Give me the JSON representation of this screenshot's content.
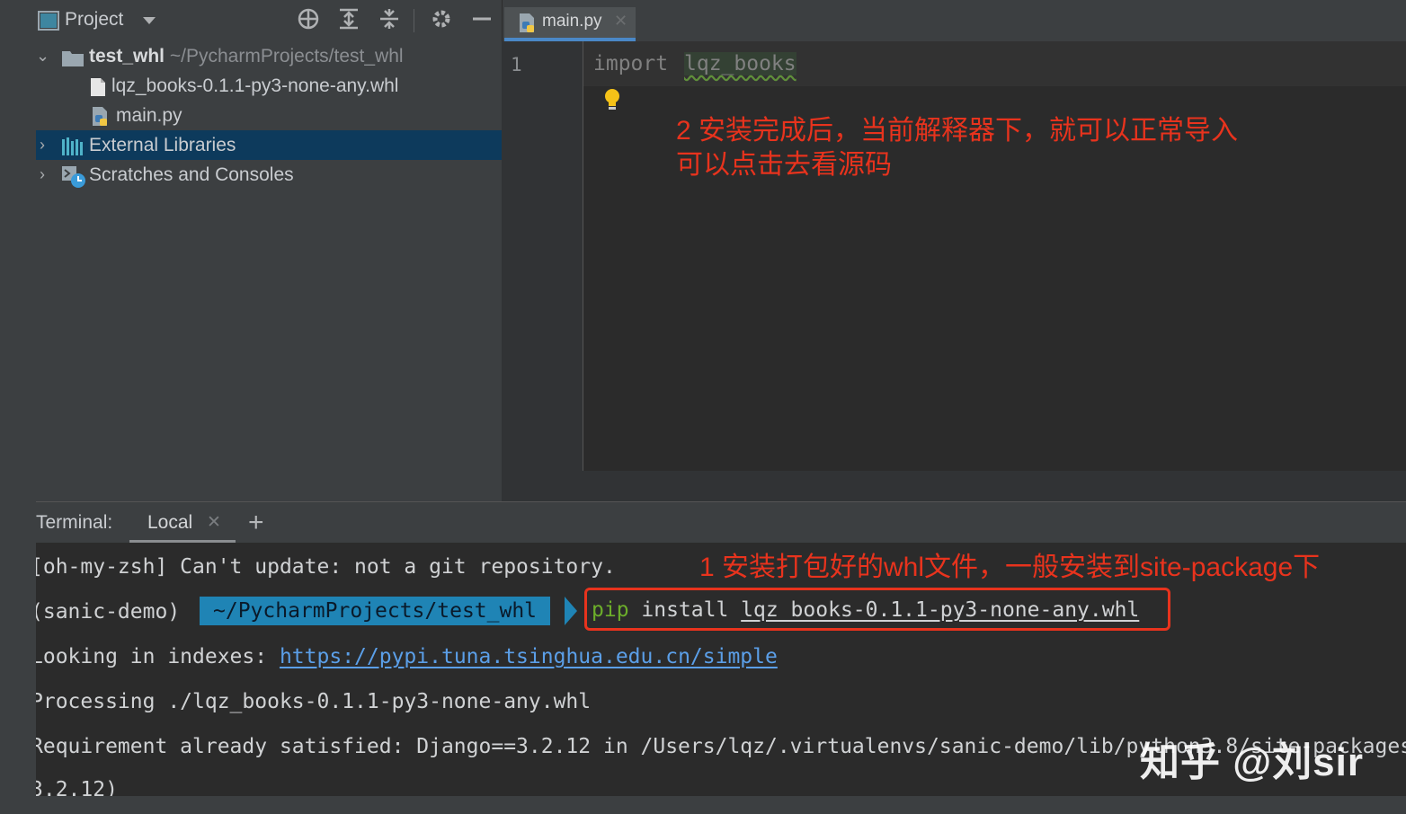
{
  "project_panel": {
    "title": "Project",
    "tree": [
      {
        "label": "test_whl",
        "path": "~/PycharmProjects/test_whl",
        "icon": "folder-icon",
        "expanded": true
      },
      {
        "label": "lqz_books-0.1.1-py3-none-any.whl",
        "icon": "file-icon"
      },
      {
        "label": "main.py",
        "icon": "python-file-icon"
      },
      {
        "label": "External Libraries",
        "icon": "library-icon",
        "selected": true
      },
      {
        "label": "Scratches and Consoles",
        "icon": "scratches-icon"
      }
    ]
  },
  "editor": {
    "tab_label": "main.py",
    "line_number": "1",
    "code_keyword": "import",
    "code_module": "lqz_books",
    "annotation_line1": "2 安装完成后，当前解释器下，就可以正常导入",
    "annotation_line2": "可以点击去看源码"
  },
  "terminal": {
    "title": "Terminal:",
    "tab_label": "Local",
    "annotation": "1 安装打包好的whl文件，一般安装到site-package下",
    "line1": "[oh-my-zsh] Can't update: not a git repository.",
    "env": "(sanic-demo)",
    "prompt_path": "~/PycharmProjects/test_whl",
    "cmd_pip": "pip",
    "cmd_install": " install ",
    "cmd_file": "lqz_books-0.1.1-py3-none-any.whl",
    "line3_prefix": "Looking in indexes: ",
    "line3_link": "https://pypi.tuna.tsinghua.edu.cn/simple",
    "line4": "Processing ./lqz_books-0.1.1-py3-none-any.whl",
    "line5": "Requirement already satisfied: Django==3.2.12 in /Users/lqz/.virtualenvs/sanic-demo/lib/python3.8/site-packages",
    "line6": "3.2.12)"
  },
  "watermark": "知乎 @刘sir",
  "colors": {
    "accent": "#4a88c7",
    "annotation_red": "#e8331d",
    "selection": "#0d3a5c",
    "prompt_blue": "#1f84b5"
  }
}
